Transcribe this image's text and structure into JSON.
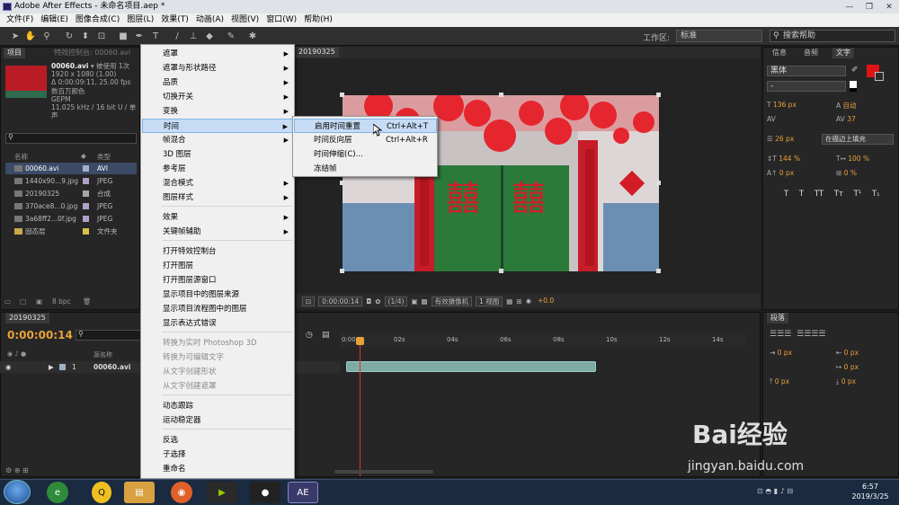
{
  "window": {
    "title": "Adobe After Effects - 未命名项目.aep *",
    "controls": [
      "—",
      "❐",
      "✕"
    ]
  },
  "menubar": [
    "文件(F)",
    "编辑(E)",
    "图像合成(C)",
    "图层(L)",
    "效果(T)",
    "动画(A)",
    "视图(V)",
    "窗口(W)",
    "帮助(H)"
  ],
  "toolbar": {
    "workspace_label": "工作区:",
    "workspace_value": "标准",
    "search_placeholder": "搜索帮助"
  },
  "project": {
    "tab_project": "项目",
    "tab_effects": "特效控制台: 00060.avi",
    "file_name": "00060.avi",
    "used": "▾ 被使用 1次",
    "info": [
      "1920 x 1080 (1.00)",
      "Δ 0:00:09:11, 25.00 fps",
      "数百万颜色",
      "GEPM",
      "11.025 kHz / 16 bit U / 单声"
    ],
    "col_name": "名称",
    "col_type": "类型",
    "items": [
      {
        "name": "00060.avi",
        "type": "AVI",
        "color": "#9fb0c8"
      },
      {
        "name": "1440x90...9.jpg",
        "type": "JPEG",
        "color": "#b0a0c8"
      },
      {
        "name": "20190325",
        "type": "合成",
        "color": "#a6a6a6"
      },
      {
        "name": "370ace8...0.jpg",
        "type": "JPEG",
        "color": "#b0a0c8"
      },
      {
        "name": "3a68ff2...0f.jpg",
        "type": "JPEG",
        "color": "#b0a0c8"
      },
      {
        "name": "固态层",
        "type": "文件夹",
        "color": "#d8c24a"
      }
    ],
    "bpc": "8 bpc"
  },
  "comp": {
    "tab": "20190325",
    "timecode": "0:00:00:14",
    "resolution": "(1/4)",
    "camera": "有效摄像机",
    "views": "1 视图",
    "exposure": "+0.0"
  },
  "context_menu": {
    "items": [
      {
        "label": "遮罩",
        "arrow": true
      },
      {
        "label": "遮罩与形状路径",
        "arrow": true
      },
      {
        "label": "品质",
        "arrow": true
      },
      {
        "label": "切换开关",
        "arrow": true
      },
      {
        "label": "变换",
        "arrow": true
      },
      {
        "label": "时间",
        "arrow": true,
        "highlight": true
      },
      {
        "label": "帧混合",
        "arrow": true
      },
      {
        "label": "3D 图层",
        "arrow": false
      },
      {
        "label": "参考层",
        "arrow": false
      },
      {
        "label": "混合模式",
        "arrow": true
      },
      {
        "label": "图层样式",
        "arrow": true
      },
      {
        "label": "效果",
        "arrow": true
      },
      {
        "label": "关键帧辅助",
        "arrow": true
      },
      {
        "label": "打开特效控制台",
        "arrow": false
      },
      {
        "label": "打开图层",
        "arrow": false
      },
      {
        "label": "打开图层源窗口",
        "arrow": false
      },
      {
        "label": "显示项目中的图层来源",
        "arrow": false
      },
      {
        "label": "显示项目流程图中的图层",
        "arrow": false
      },
      {
        "label": "显示表达式错误",
        "arrow": false
      },
      {
        "label": "转换为实时 Photoshop 3D",
        "disabled": true
      },
      {
        "label": "转换为可编辑文字",
        "disabled": true
      },
      {
        "label": "从文字创建形状",
        "disabled": true
      },
      {
        "label": "从文字创建遮罩",
        "disabled": true
      },
      {
        "label": "动态跟踪",
        "arrow": false
      },
      {
        "label": "运动稳定器",
        "arrow": false
      },
      {
        "label": "反选",
        "arrow": false
      },
      {
        "label": "子选择",
        "arrow": false
      },
      {
        "label": "重命名",
        "arrow": false
      }
    ]
  },
  "submenu": {
    "items": [
      {
        "label": "启用时间重置",
        "shortcut": "Ctrl+Alt+T",
        "highlight": true
      },
      {
        "label": "时间反向层",
        "shortcut": "Ctrl+Alt+R"
      },
      {
        "label": "时间伸缩(C)...",
        "shortcut": ""
      },
      {
        "label": "冻结帧",
        "shortcut": ""
      }
    ]
  },
  "right_panel": {
    "tabs": [
      "信息",
      "音频",
      "文字"
    ],
    "font": "黑体",
    "style": "-",
    "size": "136 px",
    "leading": "自动",
    "tracking": "37",
    "stroke_size": "26 px",
    "stroke_mode": "在描边上填充",
    "vscale": "144 %",
    "hscale": "100 %",
    "baseline": "0 px",
    "tsume": "0 %",
    "type_styles": [
      "T",
      "T",
      "TT",
      "Tт",
      "T¹",
      "T₁"
    ]
  },
  "paragraph": {
    "tab": "段落",
    "values": [
      "0 px",
      "0 px",
      "0 px",
      "0 px",
      "0 px"
    ]
  },
  "timeline": {
    "tab": "20190325",
    "time": "0:00:00:14",
    "ticks": [
      "0:00s",
      "02s",
      "04s",
      "06s",
      "08s",
      "10s",
      "12s",
      "14s"
    ],
    "col_source": "源名称",
    "layer_index": "1",
    "layer_name": "00060.avi"
  },
  "taskbar": {
    "time": "6:57",
    "date": "2019/3/25",
    "ae_label": "AE"
  },
  "watermark": {
    "brand": "Bai经验",
    "url": "jingyan.baidu.com"
  },
  "colors": {
    "accent": "#e8a23a",
    "menu_highlight": "#c6dcf5",
    "swatch": "#e01414"
  }
}
